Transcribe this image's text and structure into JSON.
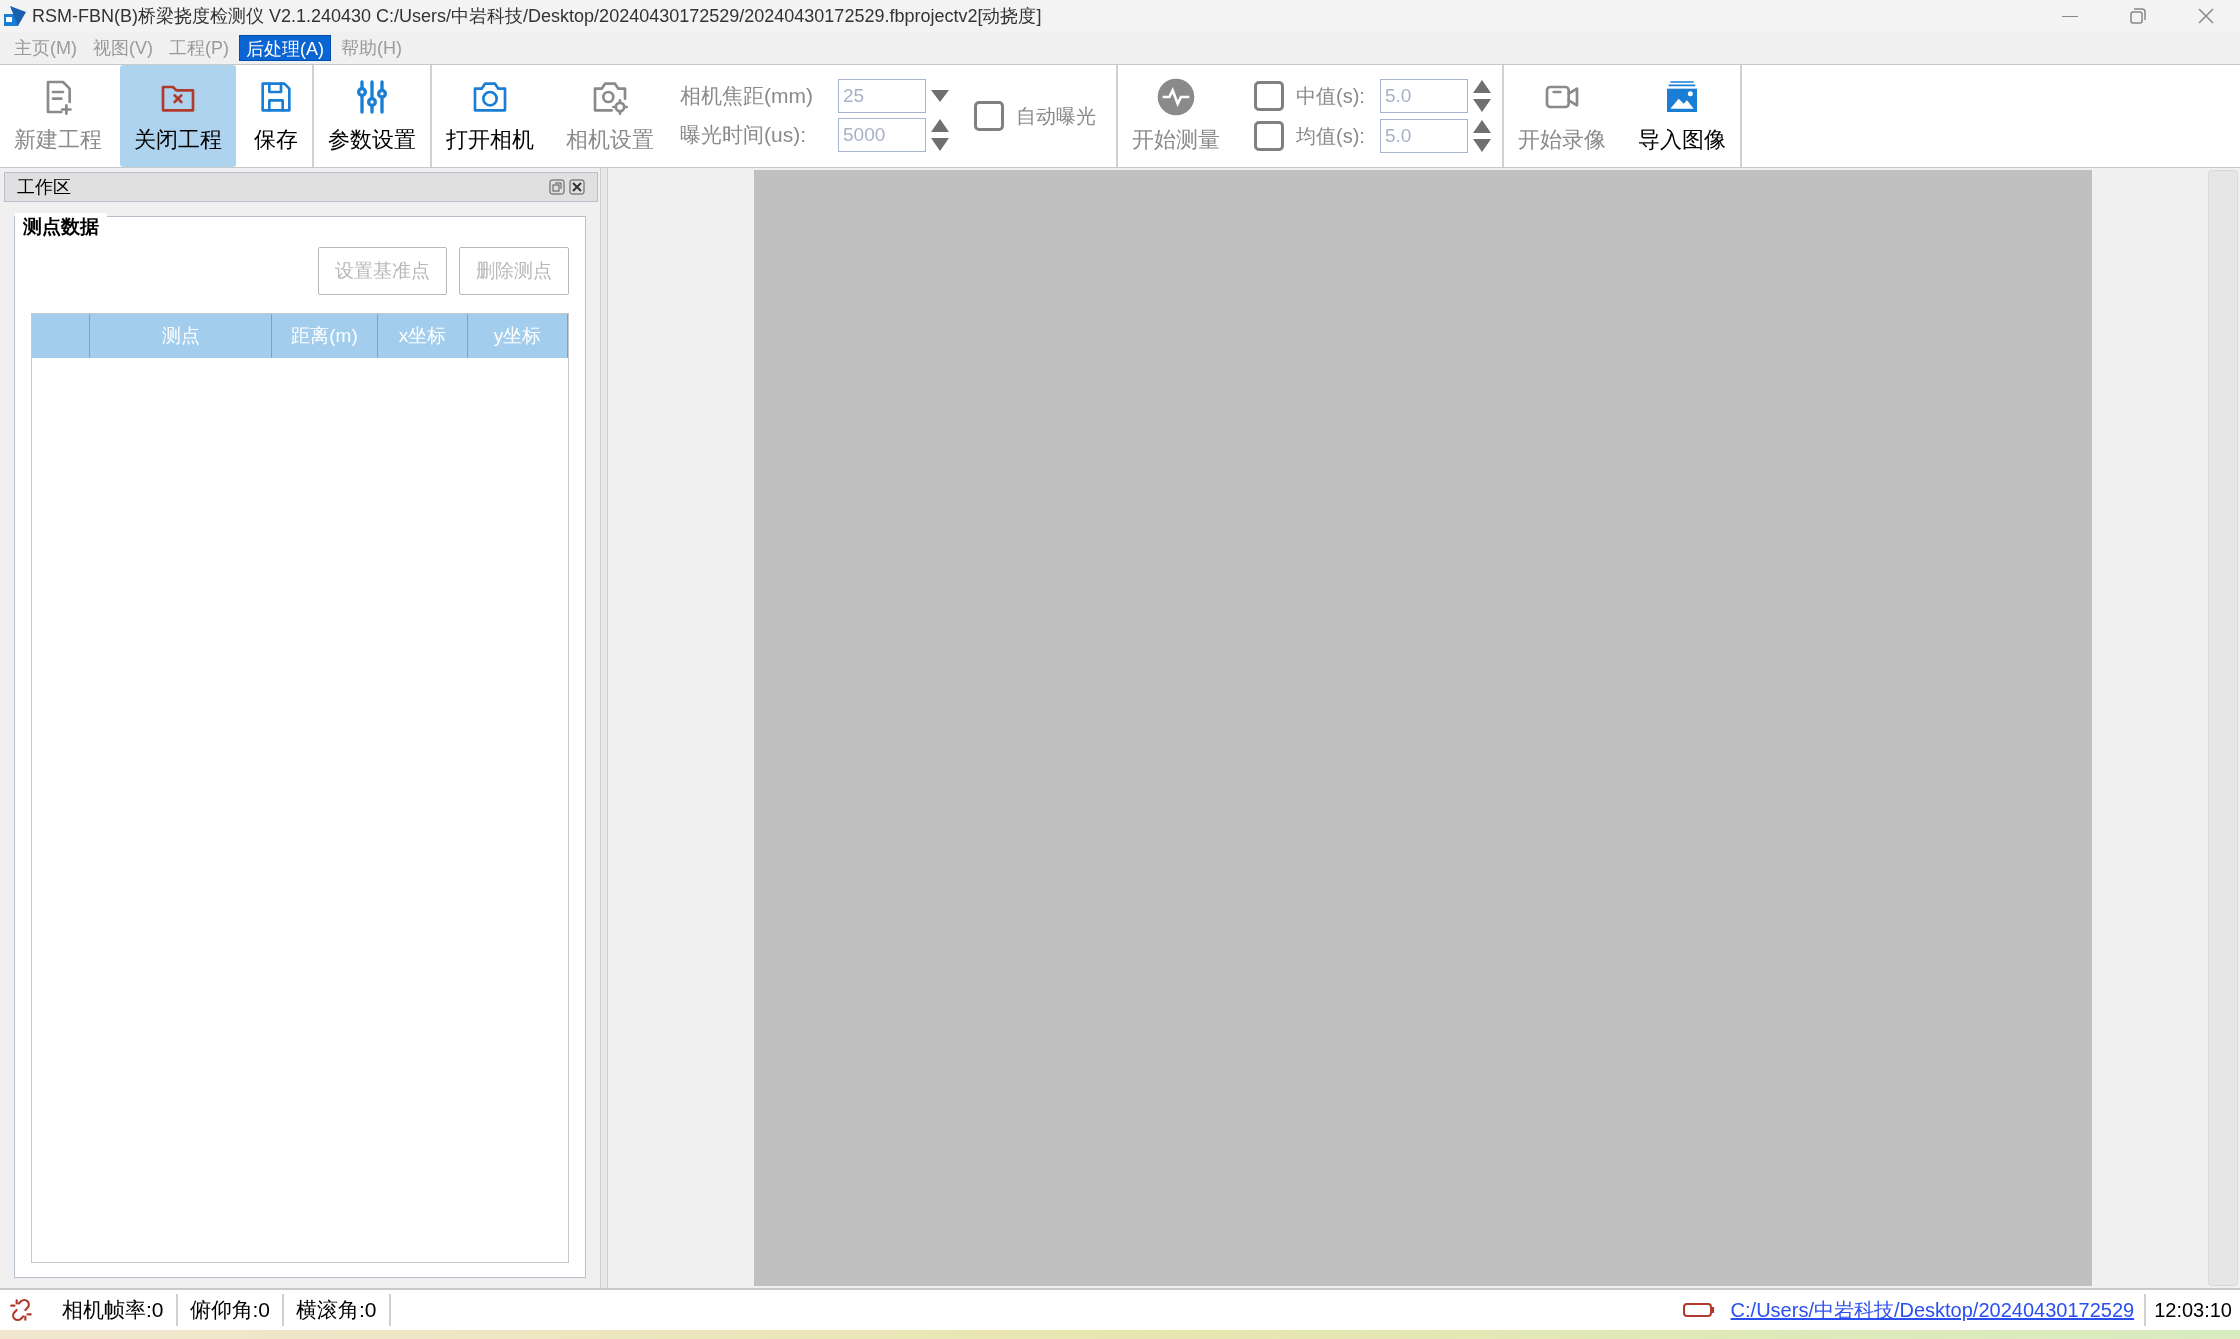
{
  "window": {
    "title": "RSM-FBN(B)桥梁挠度检测仪 V2.1.240430 C:/Users/中岩科技/Desktop/20240430172529/20240430172529.fbprojectv2[动挠度]"
  },
  "menu": [
    {
      "label": "主页(M)",
      "selected": false,
      "disabled": true
    },
    {
      "label": "视图(V)",
      "selected": false,
      "disabled": true
    },
    {
      "label": "工程(P)",
      "selected": false,
      "disabled": true
    },
    {
      "label": "后处理(A)",
      "selected": true,
      "disabled": false
    },
    {
      "label": "帮助(H)",
      "selected": false,
      "disabled": true
    }
  ],
  "toolbar": [
    [
      {
        "kind": "button",
        "label": "新建工程",
        "disabled": true,
        "selected": false
      },
      {
        "kind": "button",
        "label": "关闭工程",
        "disabled": false,
        "selected": true
      },
      {
        "kind": "button",
        "label": "保存",
        "disabled": false,
        "selected": false
      }
    ],
    [
      {
        "kind": "button",
        "label": "参数设置",
        "disabled": false,
        "selected": false
      }
    ],
    [
      {
        "kind": "button",
        "label": "打开相机",
        "disabled": false,
        "selected": false
      },
      {
        "kind": "button",
        "label": "相机设置",
        "disabled": true,
        "selected": false
      },
      {
        "kind": "fields",
        "rows": [
          {
            "label": "相机焦距(mm)",
            "value": "25",
            "kind": "dropdown"
          },
          {
            "label": "曝光时间(us):",
            "value": "5000",
            "kind": "spin"
          }
        ]
      },
      {
        "kind": "checkbox",
        "label": "自动曝光",
        "checked": false
      }
    ],
    [
      {
        "kind": "button",
        "label": "开始测量",
        "disabled": true,
        "selected": false
      },
      {
        "kind": "checkfields",
        "rows": [
          {
            "label": "中值(s):",
            "value": "5.0",
            "checked": false
          },
          {
            "label": "均值(s):",
            "value": "5.0",
            "checked": false
          }
        ]
      }
    ],
    [
      {
        "kind": "button",
        "label": "开始录像",
        "disabled": true,
        "selected": false
      },
      {
        "kind": "button",
        "label": "导入图像",
        "disabled": false,
        "selected": false
      }
    ]
  ],
  "workspace": {
    "title": "工作区",
    "group_title": "测点数据",
    "buttons": [
      {
        "label": "设置基准点",
        "disabled": true
      },
      {
        "label": "删除测点",
        "disabled": true
      }
    ],
    "columns": [
      "测点",
      "距离(m)",
      "x坐标",
      "y坐标"
    ]
  },
  "status_bar": {
    "items": [
      "相机帧率:0",
      "俯仰角:0",
      "横滚角:0"
    ],
    "path": "C:/Users/中岩科技/Desktop/20240430172529",
    "time": "12:03:10"
  }
}
